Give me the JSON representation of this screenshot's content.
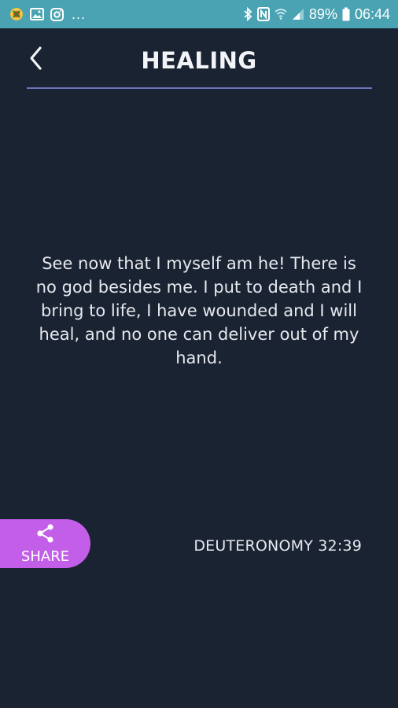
{
  "status_bar": {
    "left_icons": [
      "app-notification-icon",
      "image-icon",
      "instagram-icon"
    ],
    "overflow": "...",
    "right_icons": [
      "bluetooth-icon",
      "nfc-icon",
      "wifi-icon",
      "signal-icon"
    ],
    "battery": "89%",
    "time": "06:44",
    "color": "#4aa3b3"
  },
  "header": {
    "back_icon": "chevron-left-icon",
    "title": "HEALING",
    "rule_color": "#6b76b8"
  },
  "verse": {
    "text": "See now that I myself am he! There is no god besides me. I put to death and I bring to life, I have wounded and I will heal, and no one can deliver out of my hand.",
    "reference": "DEUTERONOMY 32:39"
  },
  "share": {
    "icon": "share-icon",
    "label": "SHARE",
    "color": "#c25ee8"
  },
  "background_color": "#1a2332"
}
